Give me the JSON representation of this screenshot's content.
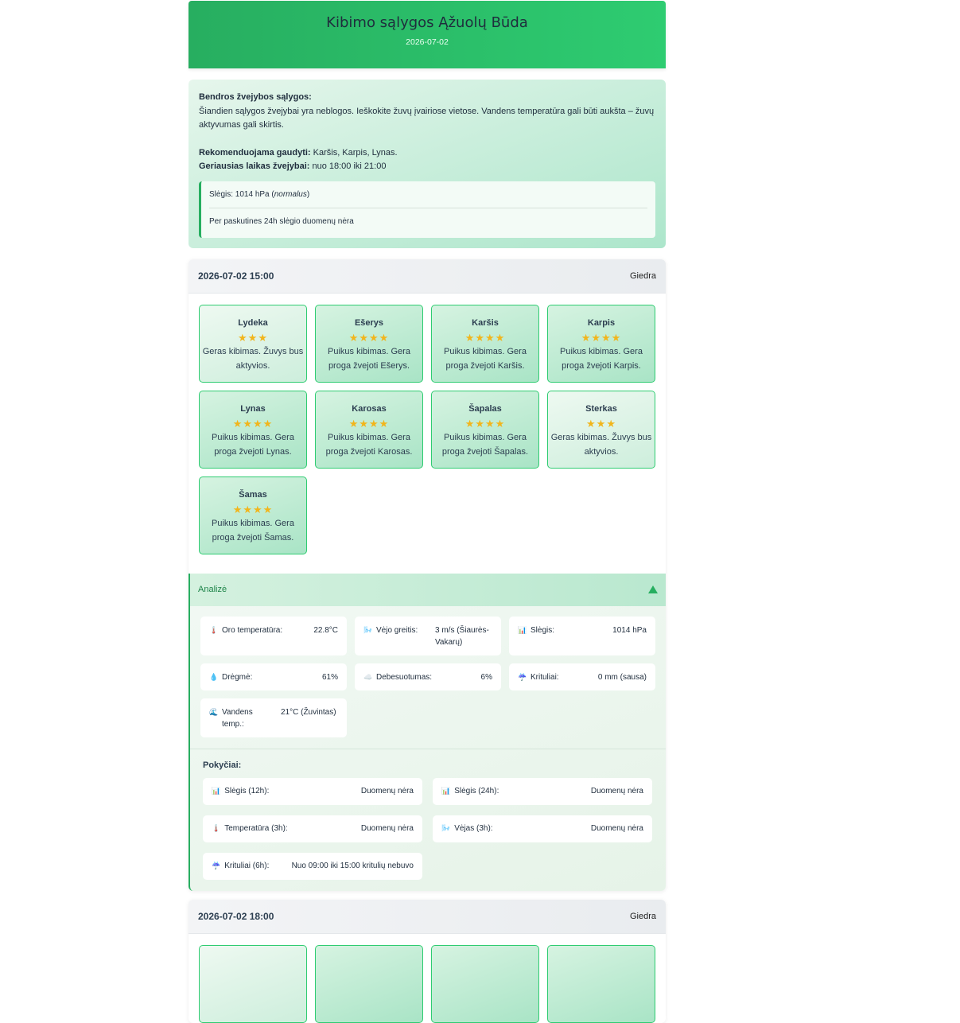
{
  "header": {
    "title": "Kibimo sąlygos Ąžuolų Būda",
    "date": "2026-07-02"
  },
  "summary": {
    "general_label": "Bendros žvejybos sąlygos:",
    "general_text": "Šiandien sąlygos žvejybai yra neblogos. Ieškokite žuvų įvairiose vietose. Vandens temperatūra gali būti aukšta – žuvų aktyvumas gali skirtis.",
    "recommend_label": "Rekomenduojama gaudyti:",
    "recommend_value": " Karšis, Karpis, Lynas.",
    "best_time_label": "Geriausias laikas žvejybai:",
    "best_time_value": " nuo 18:00 iki 21:00",
    "pressure_prefix": "Slėgis: 1014 hPa (",
    "pressure_state": "normalus",
    "pressure_suffix": ")",
    "pressure_note": "Per paskutines 24h slėgio duomenų nėra"
  },
  "forecast": {
    "time": "2026-07-02 15:00",
    "condition": "Giedra",
    "fish": [
      {
        "name": "Lydeka",
        "stars": "★★★",
        "desc": "Geras kibimas. Žuvys bus aktyvios.",
        "rating": 3
      },
      {
        "name": "Ešerys",
        "stars": "★★★★",
        "desc": "Puikus kibimas. Gera proga žvejoti Ešerys.",
        "rating": 4
      },
      {
        "name": "Karšis",
        "stars": "★★★★",
        "desc": "Puikus kibimas. Gera proga žvejoti Karšis.",
        "rating": 4
      },
      {
        "name": "Karpis",
        "stars": "★★★★",
        "desc": "Puikus kibimas. Gera proga žvejoti Karpis.",
        "rating": 4
      },
      {
        "name": "Lynas",
        "stars": "★★★★",
        "desc": "Puikus kibimas. Gera proga žvejoti Lynas.",
        "rating": 4
      },
      {
        "name": "Karosas",
        "stars": "★★★★",
        "desc": "Puikus kibimas. Gera proga žvejoti Karosas.",
        "rating": 4
      },
      {
        "name": "Šapalas",
        "stars": "★★★★",
        "desc": "Puikus kibimas. Gera proga žvejoti Šapalas.",
        "rating": 4
      },
      {
        "name": "Sterkas",
        "stars": "★★★",
        "desc": "Geras kibimas. Žuvys bus aktyvios.",
        "rating": 3
      },
      {
        "name": "Šamas",
        "stars": "★★★★",
        "desc": "Puikus kibimas. Gera proga žvejoti Šamas.",
        "rating": 4
      }
    ],
    "analysis": {
      "title": "Analizė",
      "metrics": [
        {
          "icon": "🌡️",
          "label": "Oro temperatūra:",
          "value": "22.8°C"
        },
        {
          "icon": "🌬️",
          "label": "Vėjo greitis:",
          "value": "3 m/s (Šiaurės-Vakarų)"
        },
        {
          "icon": "📊",
          "label": "Slėgis:",
          "value": "1014 hPa"
        },
        {
          "icon": "💧",
          "label": "Drėgmė:",
          "value": "61%"
        },
        {
          "icon": "☁️",
          "label": "Debesuotumas:",
          "value": "6%"
        },
        {
          "icon": "☔",
          "label": "Krituliai:",
          "value": "0 mm (sausa)"
        },
        {
          "icon": "🌊",
          "label": "Vandens temp.:",
          "value": "21°C (Žuvintas)"
        }
      ],
      "changes_title": "Pokyčiai:",
      "changes": [
        {
          "icon": "📊",
          "label": "Slėgis (12h):",
          "value": "Duomenų nėra"
        },
        {
          "icon": "📊",
          "label": "Slėgis (24h):",
          "value": "Duomenų nėra"
        },
        {
          "icon": "🌡️",
          "label": "Temperatūra (3h):",
          "value": "Duomenų nėra"
        },
        {
          "icon": "🌬️",
          "label": "Vėjas (3h):",
          "value": "Duomenų nėra"
        },
        {
          "icon": "☔",
          "label": "Krituliai (6h):",
          "value": "Nuo 09:00 iki 15:00 kritulių nebuvo"
        }
      ]
    }
  },
  "forecast2": {
    "time": "2026-07-02 18:00",
    "condition": "Giedra"
  },
  "colors": {
    "brand_green": "#27ae60",
    "accent_green": "#2ecc71",
    "star": "#f1b51c"
  }
}
